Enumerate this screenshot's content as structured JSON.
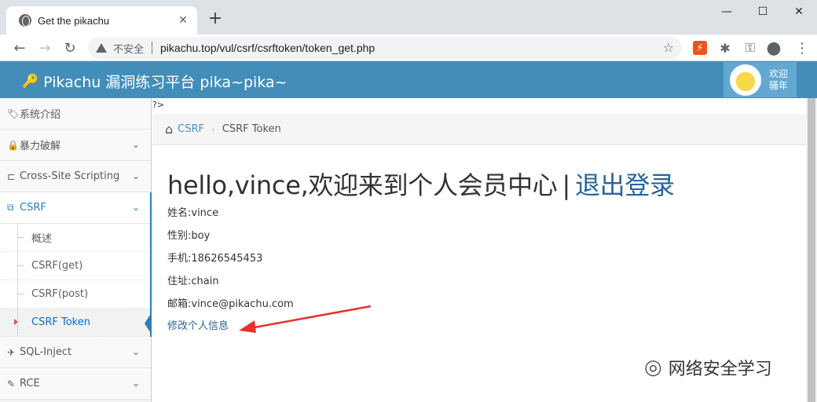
{
  "browser": {
    "tab_title": "Get the pikachu",
    "new_tab": "+",
    "close": "✕",
    "minimize": "—",
    "maximize": "☐",
    "win_close": "✕",
    "back": "←",
    "forward": "→",
    "reload": "↻",
    "not_secure": "不安全",
    "url": "pikachu.top/vul/csrf/csrftoken/token_get.php",
    "star": "☆",
    "ext_red": "⚡",
    "ext_puzzle": "✱",
    "ext_key": "⚿",
    "profile": "●",
    "menu": "⋮"
  },
  "header": {
    "brand": "Pikachu 漏洞练习平台 pika~pika~",
    "key_icon": "🔑",
    "welcome_line1": "欢迎",
    "welcome_line2": "骚年"
  },
  "sidebar": {
    "items": [
      {
        "label": "系统介绍",
        "icon": "🏷"
      },
      {
        "label": "暴力破解",
        "icon": "🔒"
      },
      {
        "label": "Cross-Site Scripting",
        "icon": "⊏"
      },
      {
        "label": "CSRF",
        "icon": "⧉"
      },
      {
        "label": "SQL-Inject",
        "icon": "✈"
      },
      {
        "label": "RCE",
        "icon": "✎"
      }
    ],
    "csrf_sub": [
      "概述",
      "CSRF(get)",
      "CSRF(post)",
      "CSRF Token"
    ],
    "chevron_down": "⌄"
  },
  "content": {
    "stray": "?>",
    "breadcrumb": {
      "home_icon": "⌂",
      "parent": "CSRF",
      "sep": "›",
      "current": "CSRF Token"
    },
    "hello": "hello,vince,欢迎来到个人会员中心",
    "pipe": "|",
    "logout": "退出登录",
    "fields": [
      "姓名:vince",
      "性别:boy",
      "手机:18626545453",
      "住址:chain",
      "邮箱:vince@pikachu.com"
    ],
    "edit_link": "修改个人信息",
    "watermark": "网络安全学习"
  },
  "colors": {
    "header": "#438eb9",
    "accent": "#2b7dbc",
    "arrow": "#e83030"
  }
}
